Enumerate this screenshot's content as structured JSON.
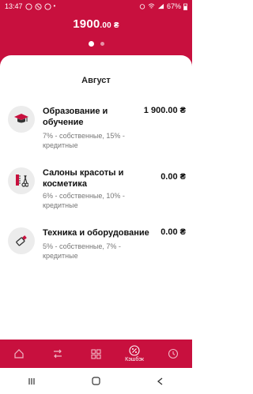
{
  "status": {
    "time": "13:47",
    "battery": "67%"
  },
  "header": {
    "amount_main": "1900",
    "amount_dec": ".00 ₴"
  },
  "card": {
    "month": "Август"
  },
  "items": [
    {
      "title": "Образование и обучение",
      "desc": "7% - собственные, 15% - кредитные",
      "value": "1 900.00 ₴",
      "icon": "graduation-cap-icon"
    },
    {
      "title": "Салоны красоты и косметика",
      "desc": "6% - собственные, 10% - кредитные",
      "value": "0.00 ₴",
      "icon": "scissors-comb-icon"
    },
    {
      "title": "Техника и оборудование",
      "desc": "5% - собственные, 7% - кредитные",
      "value": "0.00 ₴",
      "icon": "usb-device-icon"
    }
  ],
  "nav": {
    "cashback_label": "Кэшбэк"
  },
  "colors": {
    "accent": "#c8103e"
  }
}
